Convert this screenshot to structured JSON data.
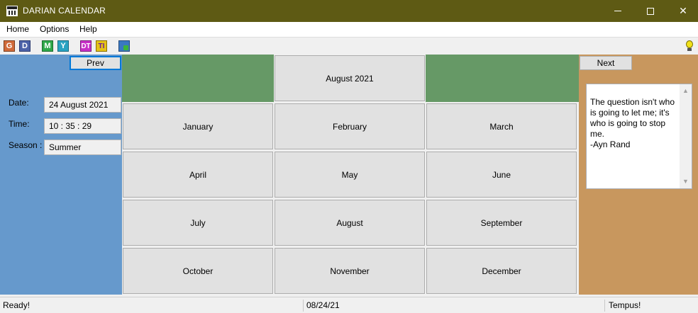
{
  "window": {
    "title": "DARIAN CALENDAR"
  },
  "menu": {
    "items": [
      "Home",
      "Options",
      "Help"
    ]
  },
  "toolbar": {
    "buttons": [
      {
        "label": "G",
        "icon": "gregorian-icon"
      },
      {
        "label": "D",
        "icon": "darian-icon"
      },
      {
        "label": "M",
        "icon": "month-icon"
      },
      {
        "label": "Y",
        "icon": "year-icon"
      },
      {
        "label": "DT",
        "icon": "datetime-icon"
      },
      {
        "label": "TI",
        "icon": "time-icon"
      }
    ],
    "exit_icon": "exit-icon",
    "tip_icon": "lightbulb-icon"
  },
  "nav": {
    "prev_label": "Prev",
    "next_label": "Next"
  },
  "info": {
    "date_label": "Date:",
    "date_value": "24 August 2021",
    "time_label": "Time:",
    "time_value": "10 : 35 : 29",
    "season_label": "Season :",
    "season_value": "Summer"
  },
  "calendar": {
    "header": "August 2021",
    "months": [
      "January",
      "February",
      "March",
      "April",
      "May",
      "June",
      "July",
      "August",
      "September",
      "October",
      "November",
      "December"
    ]
  },
  "quote": {
    "text": "The question isn't who is going to let me; it's who is going to stop me.\n-Ayn Rand"
  },
  "status": {
    "left": "Ready!",
    "middle": "08/24/21",
    "right": "Tempus!"
  },
  "colors": {
    "titlebar": "#5e5a14",
    "left_panel": "#6699cc",
    "right_panel": "#c8975e",
    "header_band": "#669966"
  }
}
